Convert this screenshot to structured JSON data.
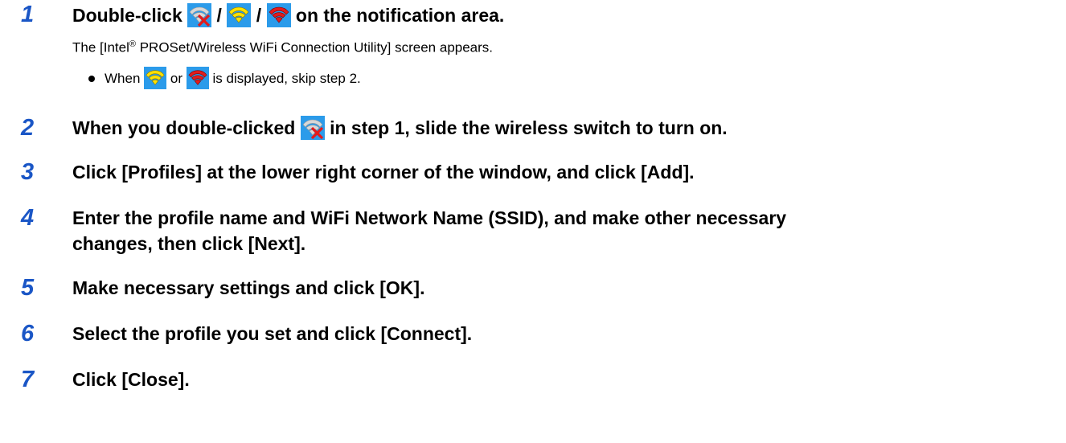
{
  "steps": [
    {
      "number": "1",
      "title_parts": [
        "Double-click",
        "/",
        "/",
        "on the notification area."
      ],
      "description_parts": [
        "The [Intel",
        "®",
        " PROSet/Wireless WiFi Connection Utility] screen appears."
      ],
      "note_parts": [
        "When",
        "or",
        "is displayed, skip step 2."
      ]
    },
    {
      "number": "2",
      "title_parts": [
        "When you double-clicked",
        "in step 1, slide the wireless switch to turn on."
      ]
    },
    {
      "number": "3",
      "title": "Click [Profiles] at the lower right corner of the window, and click [Add]."
    },
    {
      "number": "4",
      "title_lines": [
        "Enter the profile name and WiFi Network Name (SSID), and make other necessary",
        "changes, then click [Next]."
      ]
    },
    {
      "number": "5",
      "title": "Make necessary settings and click [OK]."
    },
    {
      "number": "6",
      "title": "Select the profile you set and click [Connect]."
    },
    {
      "number": "7",
      "title": "Click [Close]."
    }
  ],
  "icons": {
    "disabled": "wifi-disabled-icon",
    "yellow": "wifi-yellow-icon",
    "red": "wifi-red-icon"
  },
  "colors": {
    "step_number": "#1a56c6",
    "icon_background": "#2b9bea",
    "wifi_yellow": "#ffe100",
    "wifi_red": "#e31b1b",
    "wifi_gray": "#d8d8d8"
  }
}
